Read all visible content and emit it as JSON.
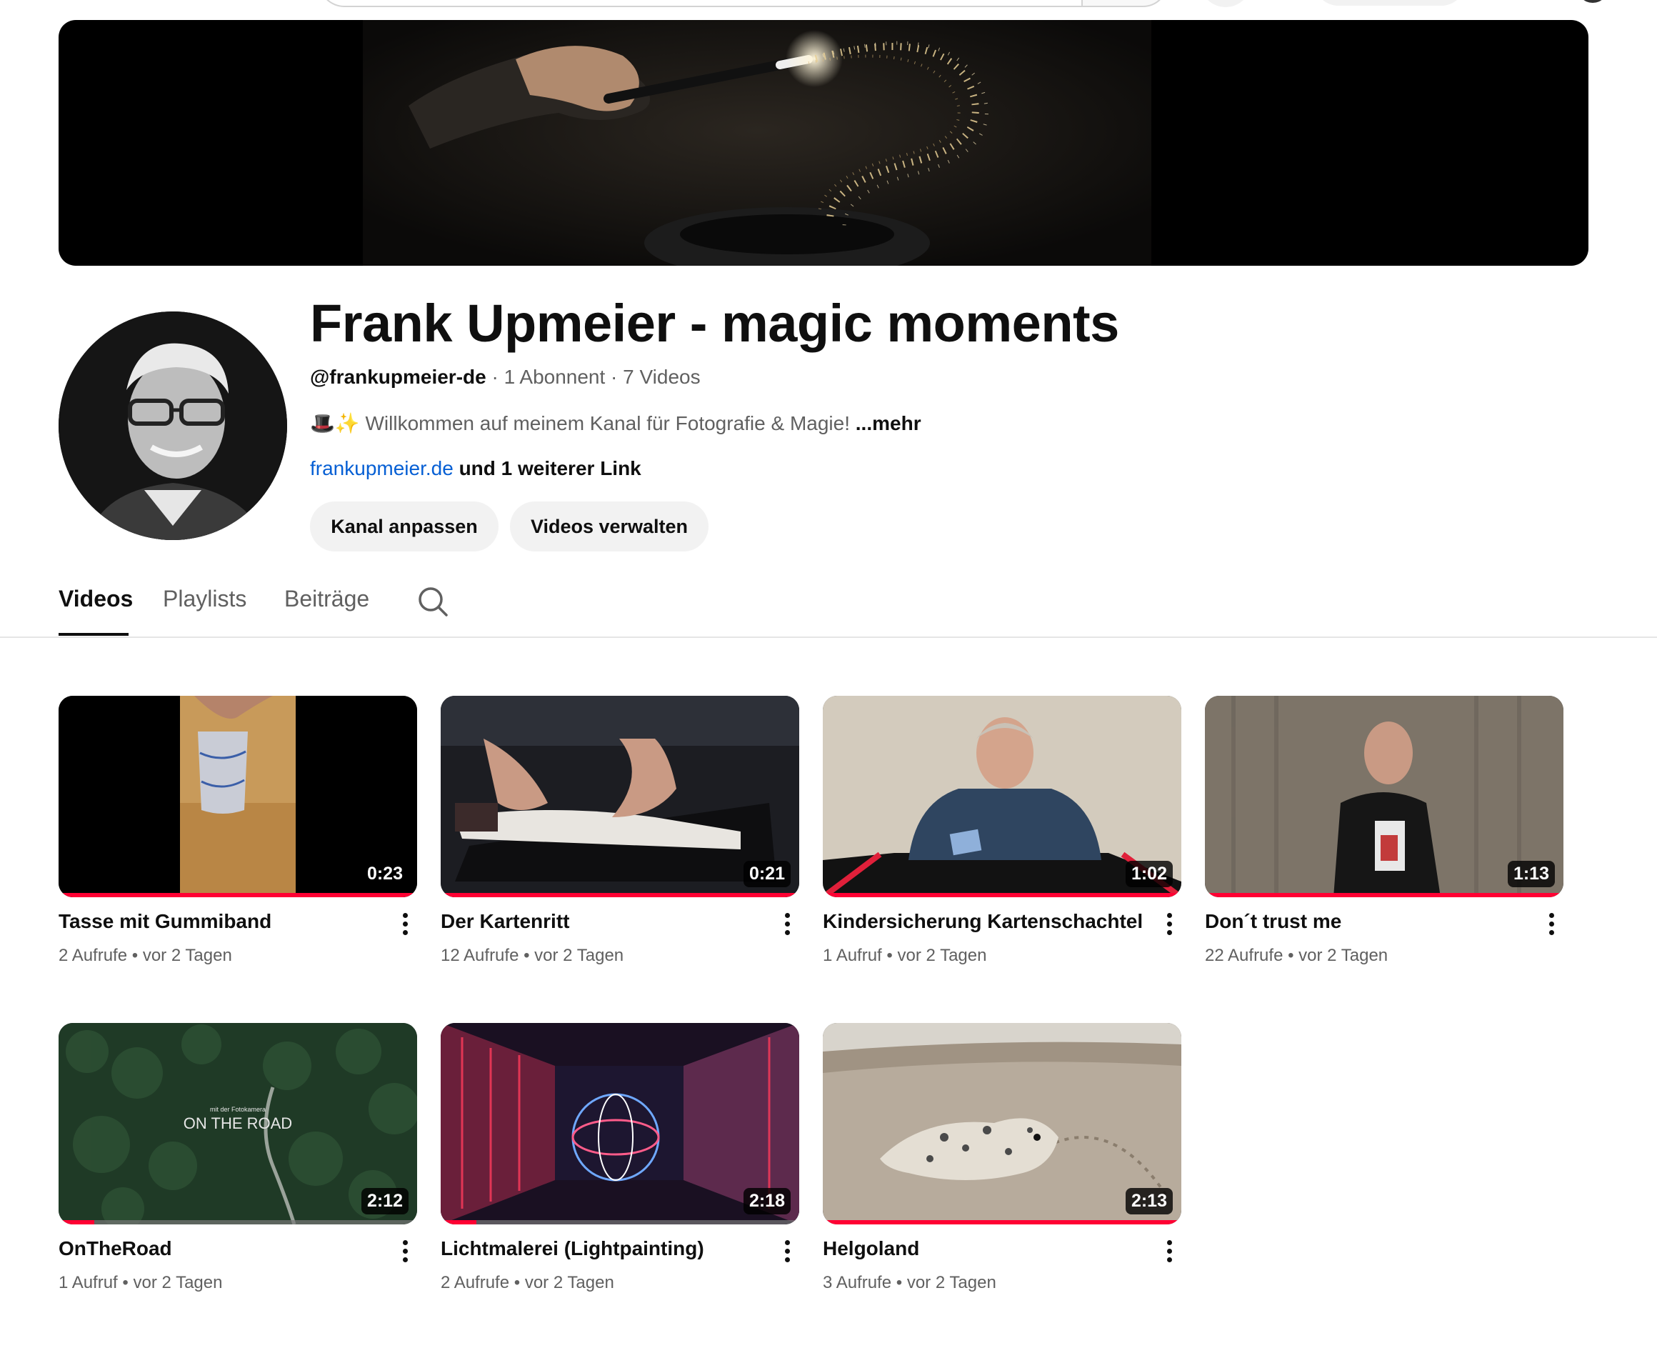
{
  "channel": {
    "title": "Frank Upmeier - magic moments",
    "handle": "@frankupmeier-de",
    "stats": " · 1 Abonnent · 7 Videos",
    "description": "🎩✨ Willkommen auf meinem Kanal für Fotografie & Magie! ",
    "description_more": "...mehr",
    "link": "frankupmeier.de",
    "link_more": " und 1 weiterer Link",
    "customize_label": "Kanal anpassen",
    "manage_label": "Videos verwalten"
  },
  "tabs": [
    {
      "label": "Videos",
      "active": true
    },
    {
      "label": "Playlists",
      "active": false
    },
    {
      "label": "Beiträge",
      "active": false
    }
  ],
  "videos": [
    {
      "title": "Tasse mit Gummiband",
      "views": "2 Aufrufe",
      "age": "vor 2 Tagen",
      "duration": "0:23",
      "watched_fraction": 1.0
    },
    {
      "title": "Der Kartenritt",
      "views": "12 Aufrufe",
      "age": "vor 2 Tagen",
      "duration": "0:21",
      "watched_fraction": 1.0
    },
    {
      "title": "Kindersicherung Kartenschachtel",
      "views": "1 Aufruf",
      "age": "vor 2 Tagen",
      "duration": "1:02",
      "watched_fraction": 1.0
    },
    {
      "title": "Don´t trust me",
      "views": "22 Aufrufe",
      "age": "vor 2 Tagen",
      "duration": "1:13",
      "watched_fraction": 1.0
    },
    {
      "title": "OnTheRoad",
      "views": "1 Aufruf",
      "age": "vor 2 Tagen",
      "duration": "2:12",
      "watched_fraction": 0.1
    },
    {
      "title": "Lichtmalerei (Lightpainting)",
      "views": "2 Aufrufe",
      "age": "vor 2 Tagen",
      "duration": "2:18",
      "watched_fraction": 0.1
    },
    {
      "title": "Helgoland",
      "views": "3 Aufrufe",
      "age": "vor 2 Tagen",
      "duration": "2:13",
      "watched_fraction": 1.0
    }
  ],
  "thumb_text": {
    "ontheroad_small": "mit der Fotokamera",
    "ontheroad_big": "ON THE ROAD"
  },
  "icons": {
    "search": "search-icon",
    "more": "more-vert-icon"
  },
  "colors": {
    "accent": "#ff0033",
    "link": "#065fd4",
    "secondary_text": "#606060",
    "chip_bg": "#f2f2f2"
  }
}
